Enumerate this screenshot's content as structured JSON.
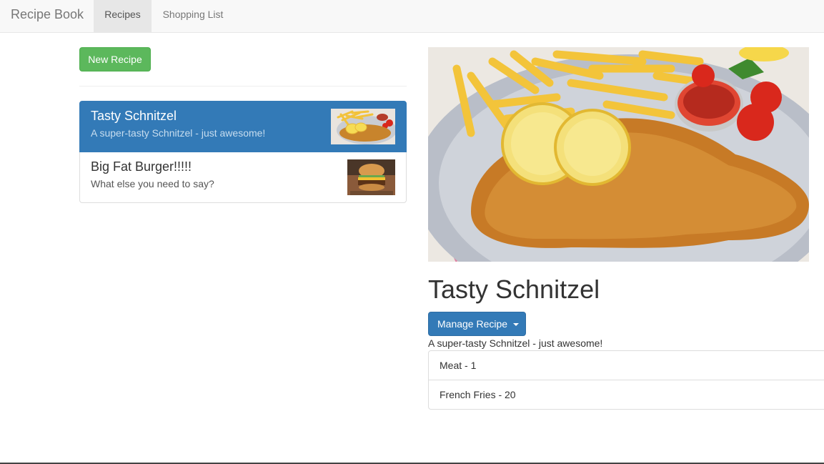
{
  "navbar": {
    "brand": "Recipe Book",
    "tabs": [
      {
        "label": "Recipes",
        "active": true
      },
      {
        "label": "Shopping List",
        "active": false
      }
    ]
  },
  "recipes": {
    "new_button": "New Recipe",
    "items": [
      {
        "name": "Tasty Schnitzel",
        "description": "A super-tasty Schnitzel - just awesome!",
        "image": "schnitzel-thumbnail",
        "active": true
      },
      {
        "name": "Big Fat Burger!!!!!",
        "description": "What else you need to say?",
        "image": "burger-thumbnail",
        "active": false
      }
    ]
  },
  "detail": {
    "image": "schnitzel-photo",
    "title": "Tasty Schnitzel",
    "manage_button": "Manage Recipe",
    "description": "A super-tasty Schnitzel - just awesome!",
    "ingredients": [
      "Meat - 1",
      "French Fries - 20"
    ]
  },
  "colors": {
    "primary": "#337ab7",
    "success": "#5cb85c",
    "navbar_bg": "#f8f8f8"
  }
}
